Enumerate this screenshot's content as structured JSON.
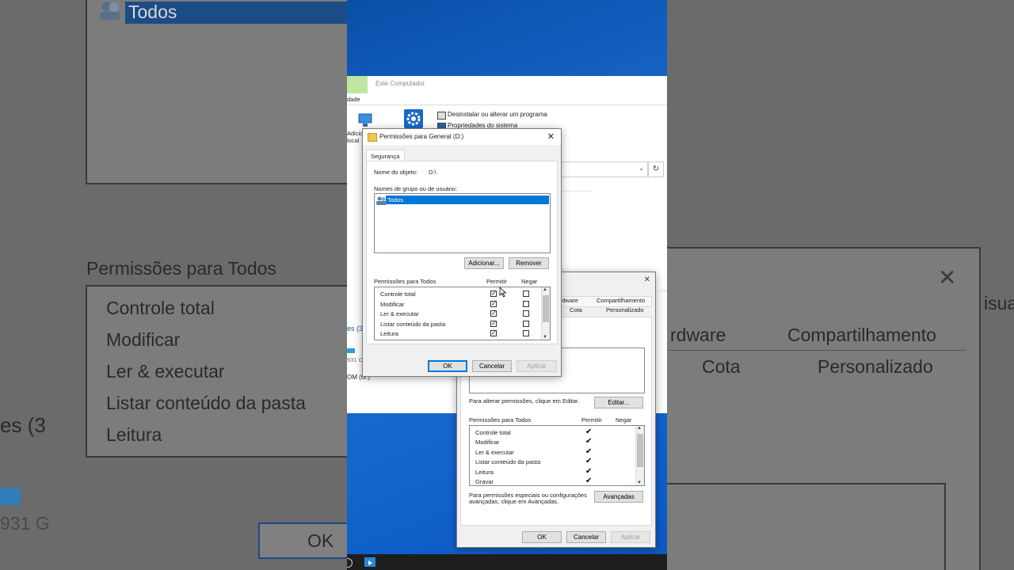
{
  "background": {
    "group_item": "Todos",
    "perm_header": "Permissões para Todos",
    "perm_items": [
      "Controle total",
      "Modificar",
      "Ler & executar",
      "Listar conteúdo da pasta",
      "Leitura"
    ],
    "drive_partial": "es (3",
    "size_partial": "931 G",
    "ok": "OK",
    "tab_hardware": "rdware",
    "tab_sharing": "Compartilhamento",
    "tab_quota": "Cota",
    "tab_custom": "Personalizado",
    "visual_partial": "isua"
  },
  "explorer": {
    "title": "Este Computador",
    "ribbon_tab_fragment": "dade",
    "uninstall": "Desinstalar ou alterar um programa",
    "system_props": "Propriedades do sistema",
    "add_fragment": "Adicio",
    "local_fragment": "local",
    "drives_fragment": "es (3",
    "size_fragment": "931 G",
    "dvd_fragment": "OM (G:)"
  },
  "permissions_dialog": {
    "title": "Permissões para General (D:)",
    "tab": "Segurança",
    "object_label": "Nome do objeto:",
    "object_value": "D:\\",
    "groups_label": "Nomes de grupo ou de usuário:",
    "groups": [
      "Todos"
    ],
    "add_button": "Adicionar...",
    "remove_button": "Remover",
    "perm_header": "Permissões para Todos",
    "allow_header": "Permitir",
    "deny_header": "Negar",
    "perms": [
      {
        "name": "Controle total",
        "allow": true,
        "deny": false
      },
      {
        "name": "Modificar",
        "allow": true,
        "deny": false
      },
      {
        "name": "Ler & executar",
        "allow": true,
        "deny": false
      },
      {
        "name": "Listar conteúdo da pasta",
        "allow": true,
        "deny": false
      },
      {
        "name": "Leitura",
        "allow": true,
        "deny": false
      }
    ],
    "ok": "OK",
    "cancel": "Cancelar",
    "apply": "Aplicar"
  },
  "properties_dialog": {
    "tab_hardware": "rdware",
    "tab_sharing": "Compartilhamento",
    "tab_quota": "Cota",
    "tab_custom": "Personalizado",
    "edit_hint": "Para alterar permissões, clique em Editar.",
    "edit_button": "Editar...",
    "perm_header": "Permissões para Todos",
    "allow_header": "Permitir",
    "deny_header": "Negar",
    "perms": [
      "Controle total",
      "Modificar",
      "Ler & executar",
      "Listar conteúdo da pasta",
      "Leitura",
      "Gravar"
    ],
    "advanced_hint_1": "Para permissões especiais ou configurações",
    "advanced_hint_2": "avançadas, clique em Avançadas.",
    "advanced_button": "Avançadas",
    "ok": "OK",
    "cancel": "Cancelar",
    "apply": "Aplicar",
    "visual_fragment": "isua"
  },
  "colors": {
    "selection": "#0078d7",
    "desktop": "#1a6fd6"
  }
}
